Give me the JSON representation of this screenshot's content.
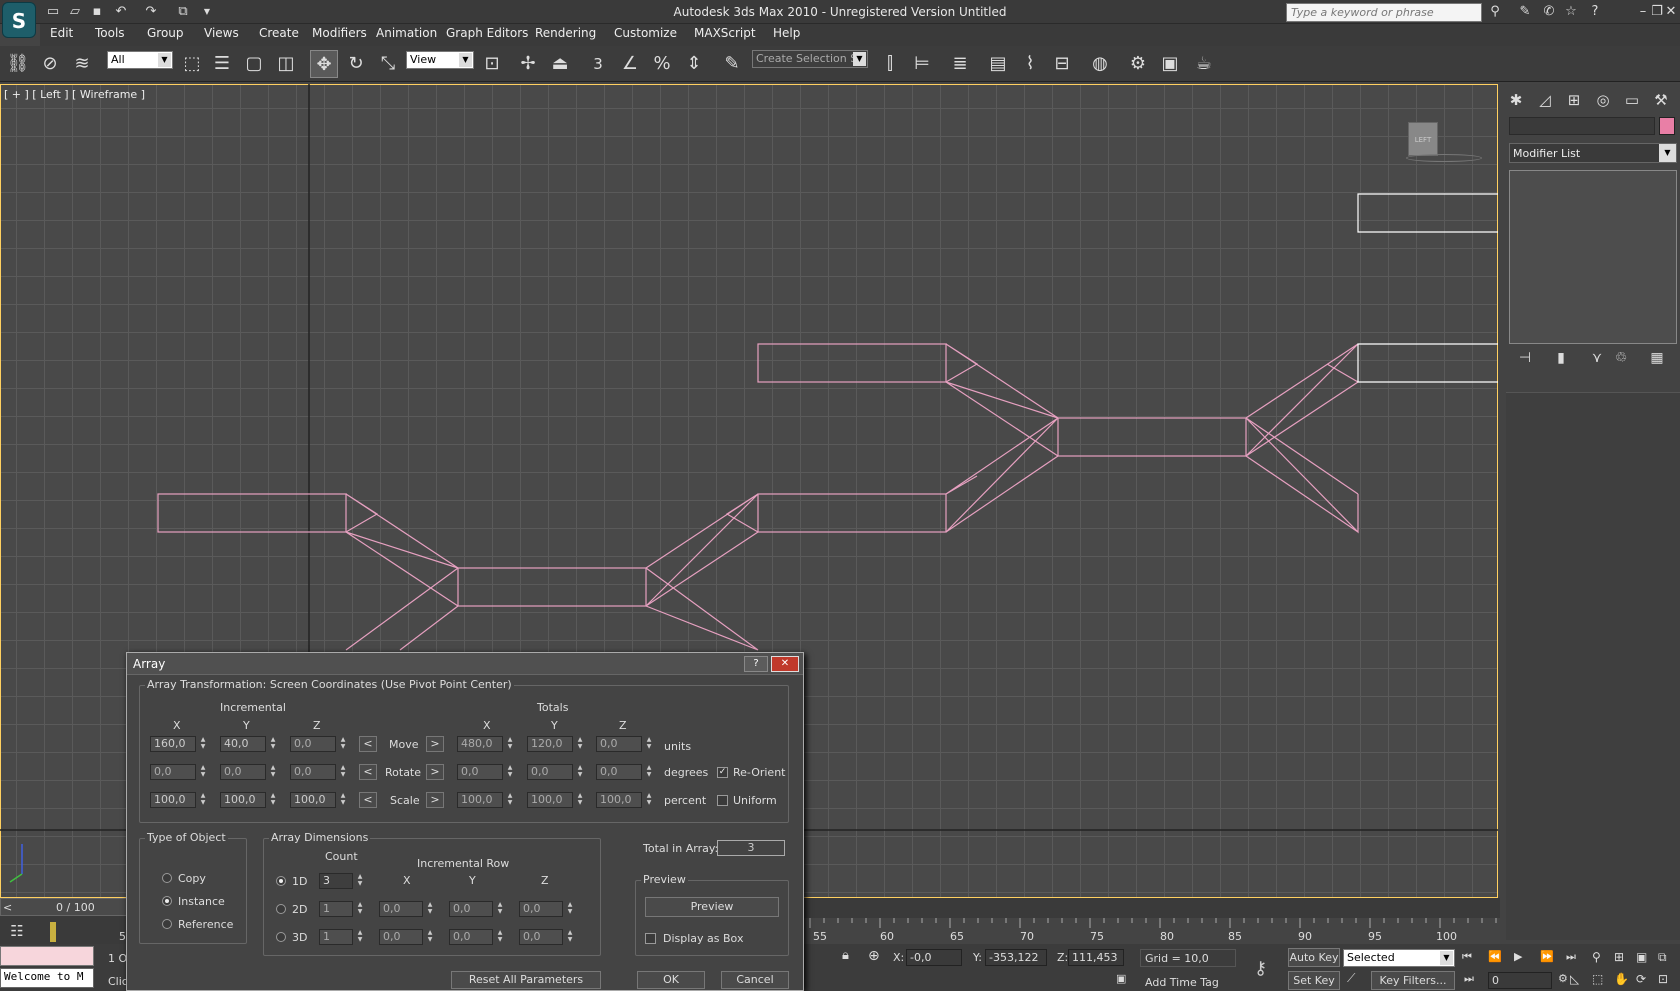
{
  "titlebar": {
    "title": "Autodesk 3ds Max  2010   -  Unregistered Version    Untitled",
    "search_placeholder": "Type a keyword or phrase"
  },
  "menu": [
    "Edit",
    "Tools",
    "Group",
    "Views",
    "Create",
    "Modifiers",
    "Animation",
    "Graph Editors",
    "Rendering",
    "Customize",
    "MAXScript",
    "Help"
  ],
  "toolbar": {
    "filter": "All",
    "refcoord": "View",
    "named_selection": "Create Selection Se",
    "snap_label": "3"
  },
  "viewport": {
    "label": "[ + ] [ Left ] [ Wireframe ]",
    "viewcube": "LEFT"
  },
  "command_panel": {
    "modifier_list": "Modifier List",
    "object_color": "#e97fa6"
  },
  "timeline": {
    "frame": "0 / 100",
    "ticks": [
      "55",
      "60",
      "65",
      "70",
      "75",
      "80",
      "85",
      "90",
      "95",
      "100"
    ],
    "tick_left": "5"
  },
  "status": {
    "welcome": "Welcome to M",
    "objects": "1 O",
    "click": "Clic",
    "x": "-0,0",
    "y": "-353,122",
    "z": "111,453",
    "grid": "Grid = 10,0",
    "add_time_tag": "Add Time Tag",
    "auto_key": "Auto Key",
    "set_key": "Set Key",
    "selected": "Selected",
    "key_filters": "Key Filters...",
    "frame_field": "0"
  },
  "dialog": {
    "title": "Array",
    "transform_group": "Array Transformation: Screen Coordinates (Use Pivot Point Center)",
    "incremental": "Incremental",
    "totals": "Totals",
    "axes": [
      "X",
      "Y",
      "Z"
    ],
    "rows": [
      {
        "label": "Move",
        "inc": [
          "160,0",
          "40,0",
          "0,0"
        ],
        "tot": [
          "480,0",
          "120,0",
          "0,0"
        ],
        "unit": "units"
      },
      {
        "label": "Rotate",
        "inc": [
          "0,0",
          "0,0",
          "0,0"
        ],
        "tot": [
          "0,0",
          "0,0",
          "0,0"
        ],
        "unit": "degrees"
      },
      {
        "label": "Scale",
        "inc": [
          "100,0",
          "100,0",
          "100,0"
        ],
        "tot": [
          "100,0",
          "100,0",
          "100,0"
        ],
        "unit": "percent"
      }
    ],
    "re_orient": "Re-Orient",
    "uniform": "Uniform",
    "type_group": "Type of Object",
    "types": [
      "Copy",
      "Instance",
      "Reference"
    ],
    "dims_group": "Array Dimensions",
    "count": "Count",
    "incremental_row": "Incremental Row",
    "dims": [
      {
        "label": "1D",
        "count": "3",
        "vals": []
      },
      {
        "label": "2D",
        "count": "1",
        "vals": [
          "0,0",
          "0,0",
          "0,0"
        ]
      },
      {
        "label": "3D",
        "count": "1",
        "vals": [
          "0,0",
          "0,0",
          "0,0"
        ]
      }
    ],
    "total_label": "Total in Array:",
    "total_value": "3",
    "preview_group": "Preview",
    "preview_btn": "Preview",
    "display_as_box": "Display as Box",
    "reset": "Reset All Parameters",
    "ok": "OK",
    "cancel": "Cancel",
    "arrow_left": "<",
    "arrow_right": ">"
  }
}
